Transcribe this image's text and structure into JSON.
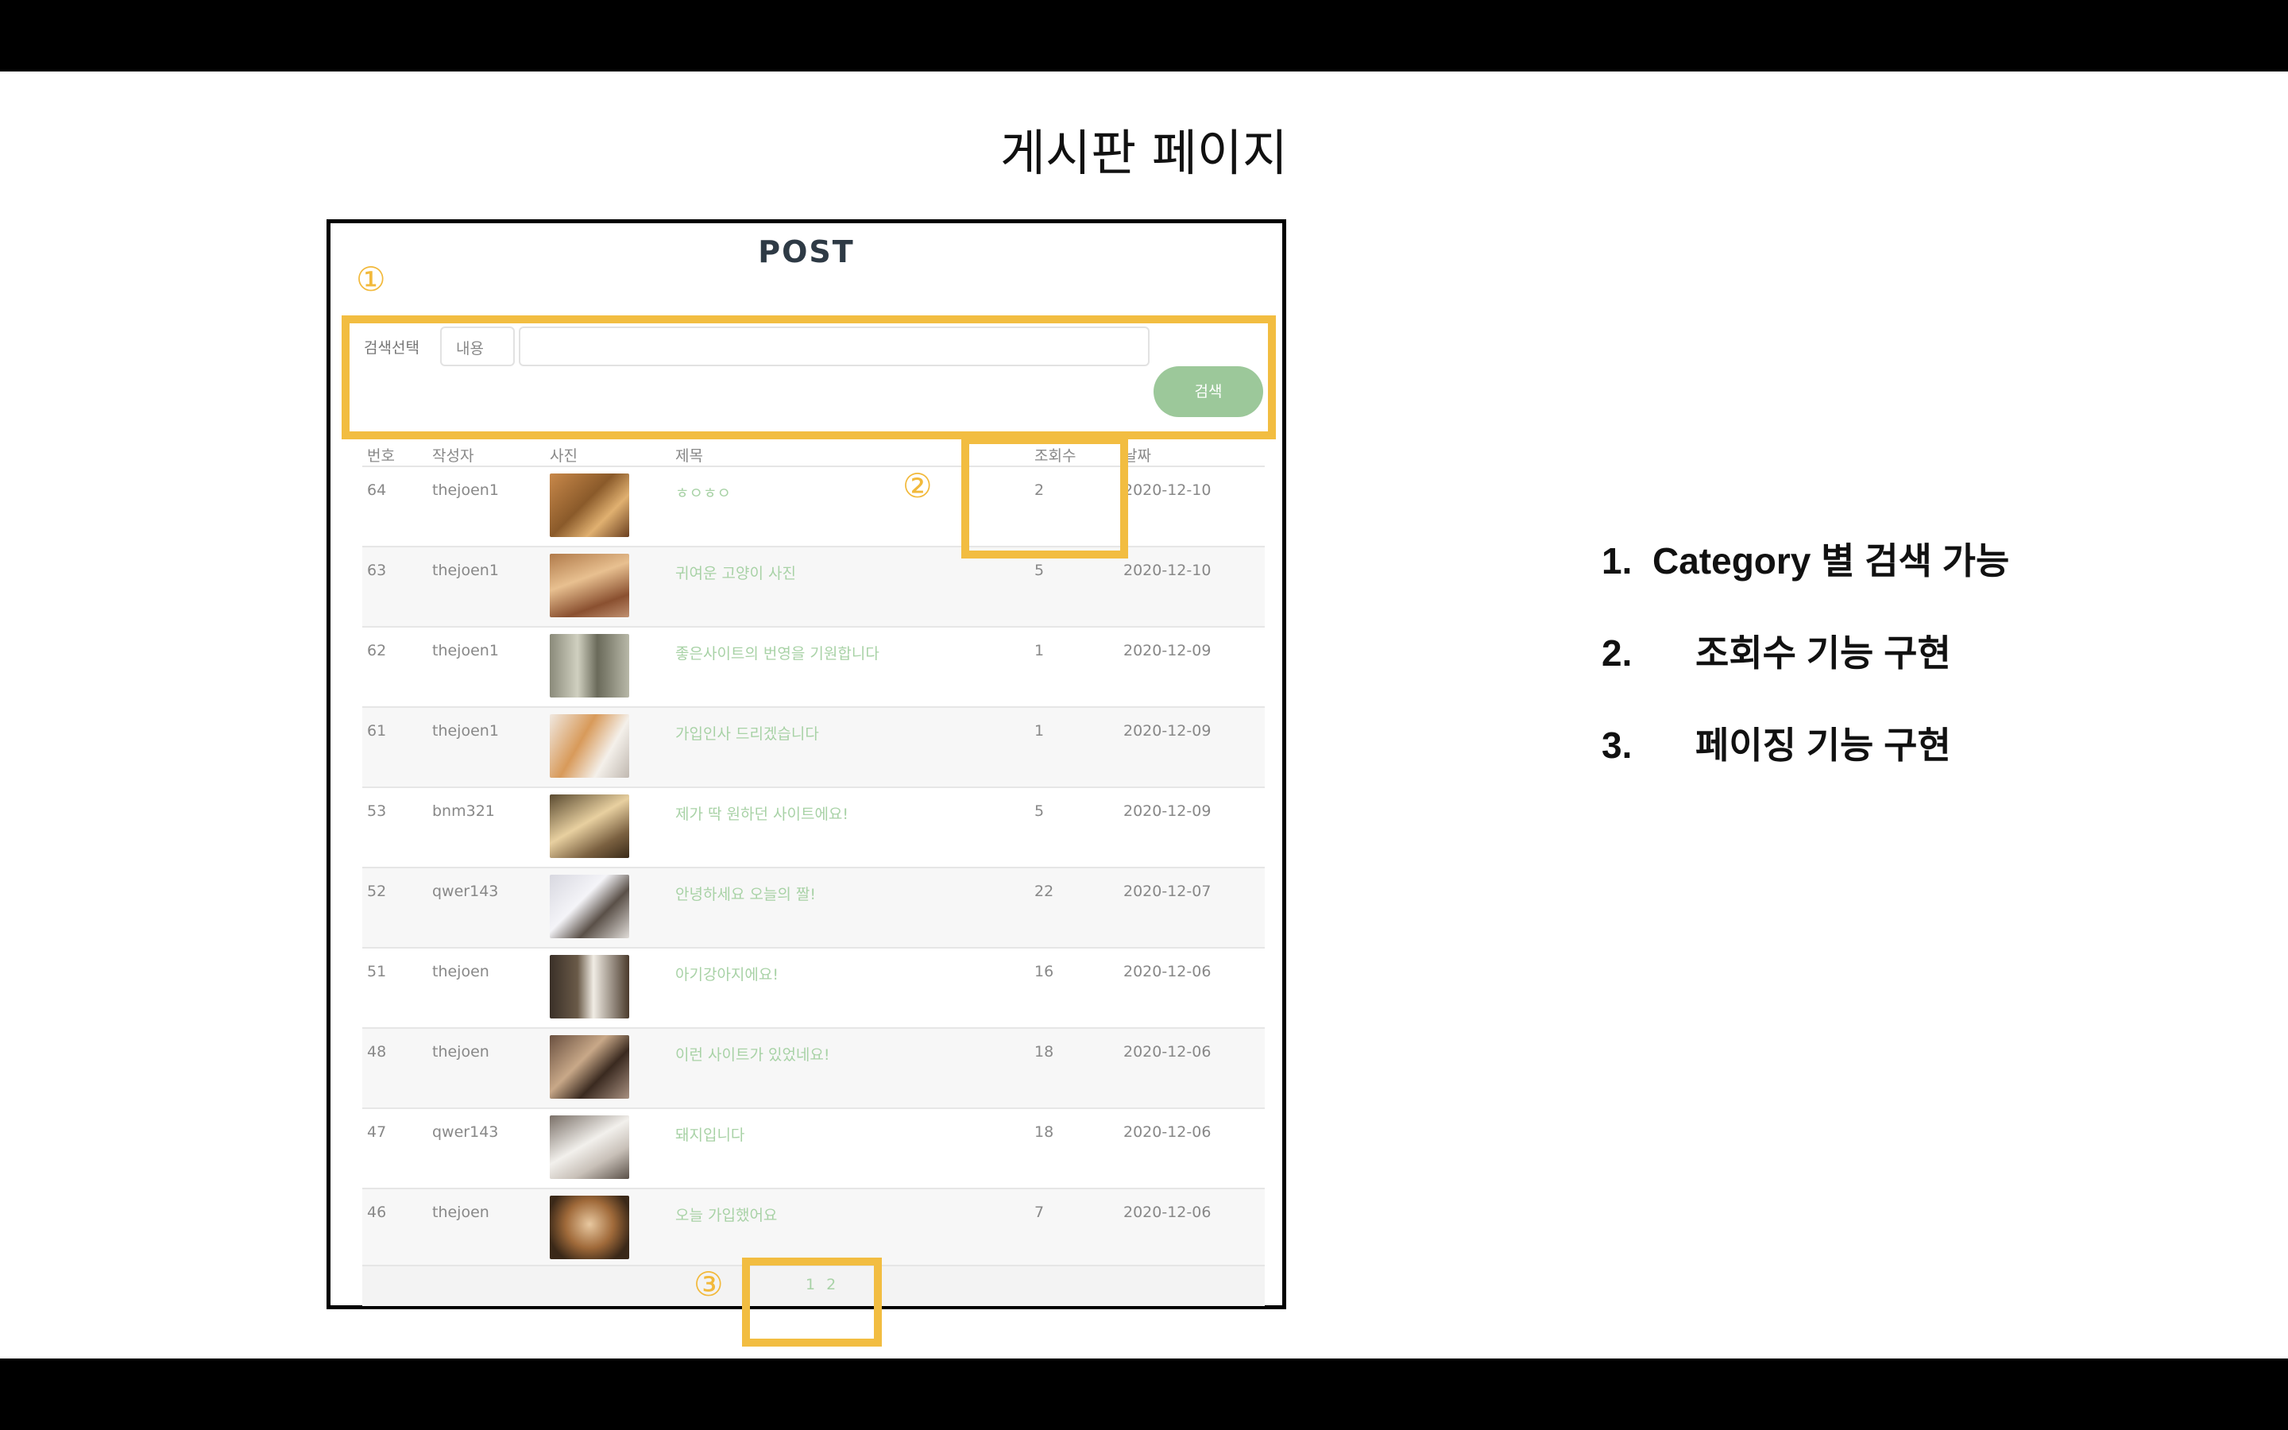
{
  "slide": {
    "title": "게시판 페이지"
  },
  "board": {
    "title": "POST",
    "markers": [
      "①",
      "②",
      "③"
    ],
    "search": {
      "label": "검색선택",
      "category": "내용",
      "query": "",
      "button": "검색"
    },
    "columns": [
      "번호",
      "작성자",
      "사진",
      "제목",
      "조회수",
      "날짜"
    ],
    "rows": [
      {
        "no": "64",
        "author": "thejoen1",
        "photo": "puppies",
        "title": "ㅎㅇㅎㅇ",
        "views": "2",
        "date": "2020-12-10"
      },
      {
        "no": "63",
        "author": "thejoen1",
        "photo": "cat",
        "title": "귀여운 고양이 사진",
        "views": "5",
        "date": "2020-12-10"
      },
      {
        "no": "62",
        "author": "thejoen1",
        "photo": "cats-window",
        "title": "좋은사이트의 번영을 기원합니다",
        "views": "1",
        "date": "2020-12-09"
      },
      {
        "no": "61",
        "author": "thejoen1",
        "photo": "corgi",
        "title": "가입인사 드리겠습니다",
        "views": "1",
        "date": "2020-12-09"
      },
      {
        "no": "53",
        "author": "bnm321",
        "photo": "puppy-box",
        "title": "제가 딱 원하던 사이트에요!",
        "views": "5",
        "date": "2020-12-09"
      },
      {
        "no": "52",
        "author": "qwer143",
        "photo": "cat-lying",
        "title": "안녕하세요 오늘의 짤!",
        "views": "22",
        "date": "2020-12-07"
      },
      {
        "no": "51",
        "author": "thejoen",
        "photo": "puppy-door",
        "title": "아기강아지에요!",
        "views": "16",
        "date": "2020-12-06"
      },
      {
        "no": "48",
        "author": "thejoen",
        "photo": "cat-dog",
        "title": "이런 사이트가 있었네요!",
        "views": "18",
        "date": "2020-12-06"
      },
      {
        "no": "47",
        "author": "qwer143",
        "photo": "white-cat",
        "title": "돼지입니다",
        "views": "18",
        "date": "2020-12-06"
      },
      {
        "no": "46",
        "author": "thejoen",
        "photo": "brown-cat",
        "title": "오늘 가입했어요",
        "views": "7",
        "date": "2020-12-06"
      }
    ],
    "pagination": "1 2"
  },
  "features": [
    {
      "num": "1.",
      "text": "Category 별 검색 가능"
    },
    {
      "num": "2.",
      "text": "조회수 기능 구현"
    },
    {
      "num": "3.",
      "text": "페이징 기능 구현"
    }
  ],
  "colors": {
    "highlight": "#f2bd41",
    "title_link": "#a8d2a6",
    "search_button": "#9cc89a"
  }
}
